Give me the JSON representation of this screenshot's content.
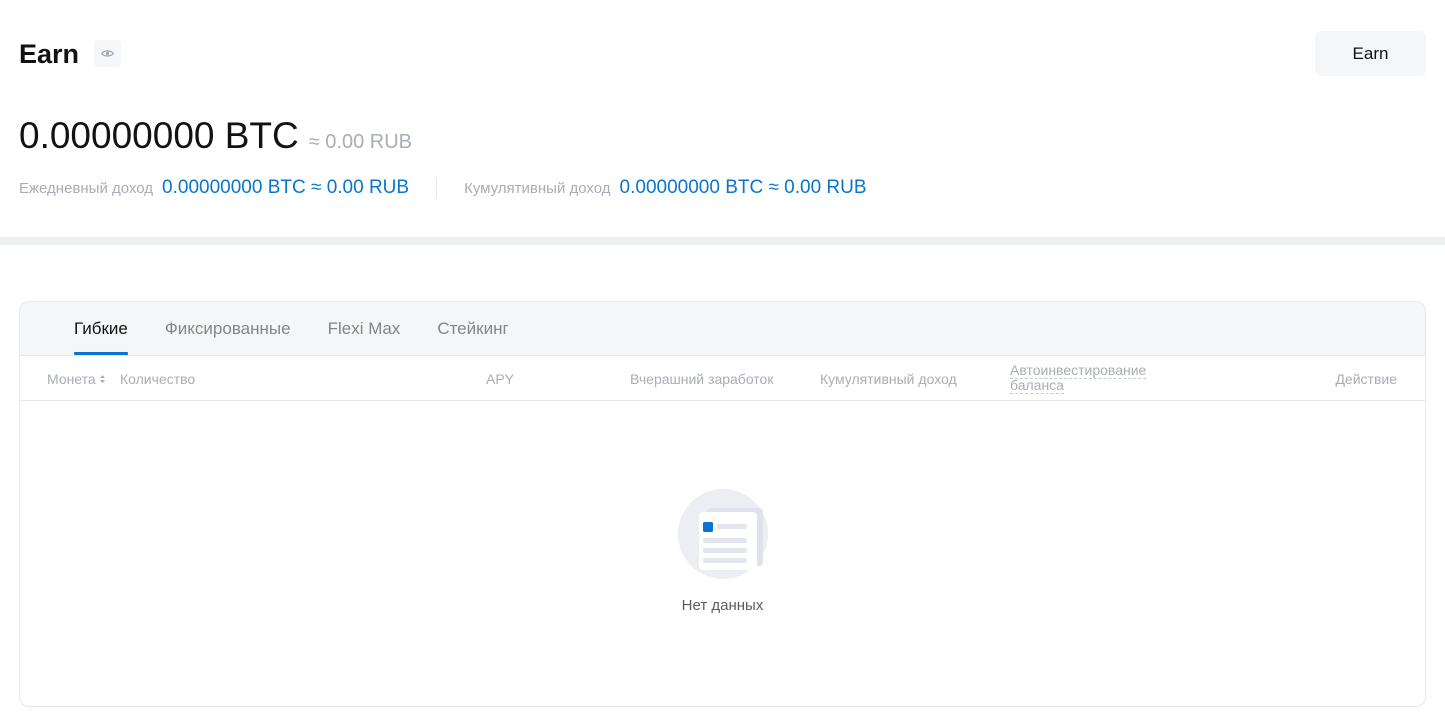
{
  "header": {
    "title": "Earn",
    "earn_button_label": "Earn",
    "eye_icon": "eye-icon"
  },
  "balance": {
    "main": "0.00000000 BTC",
    "fiat": "≈ 0.00 RUB"
  },
  "stats": {
    "daily_label": "Ежедневный доход",
    "daily_value": "0.00000000 BTC ≈ 0.00 RUB",
    "cumulative_label": "Кумулятивный доход",
    "cumulative_value": "0.00000000 BTC ≈ 0.00 RUB"
  },
  "tabs": [
    {
      "label": "Гибкие",
      "active": true
    },
    {
      "label": "Фиксированные",
      "active": false
    },
    {
      "label": "Flexi Max",
      "active": false
    },
    {
      "label": "Стейкинг",
      "active": false
    }
  ],
  "table": {
    "columns": {
      "coin": "Монета",
      "amount": "Количество",
      "apy": "APY",
      "yesterday": "Вчерашний заработок",
      "cumulative": "Кумулятивный доход",
      "auto_invest": "Автоинвестирование баланса",
      "action": "Действие"
    },
    "empty_text": "Нет данных"
  },
  "colors": {
    "accent": "#0a75cc",
    "muted_text": "#a9adb5",
    "panel_bg": "#f5f6f8"
  }
}
